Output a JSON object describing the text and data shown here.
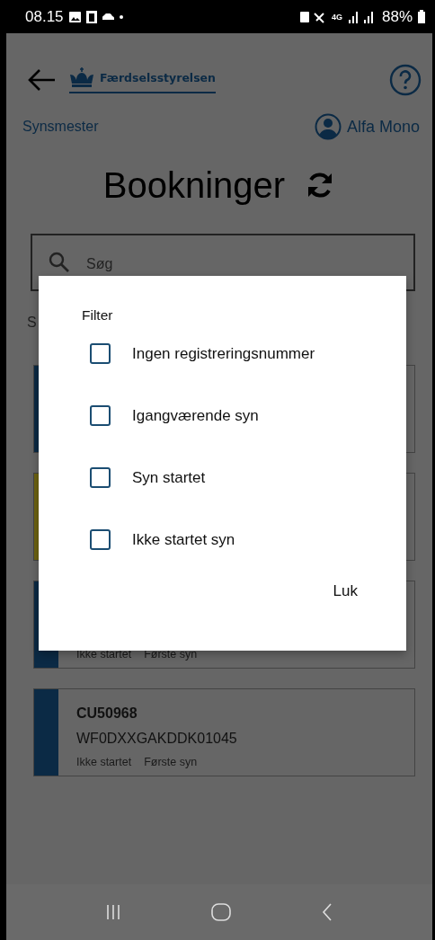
{
  "status_bar": {
    "time": "08.15",
    "network": "4G",
    "battery": "88%"
  },
  "header": {
    "logo_text": "Færdselsstyrelsen"
  },
  "role": "Synsmester",
  "user": "Alfa Mono",
  "title": "Bookninger",
  "search": {
    "placeholder": "Søg"
  },
  "section_label": "S",
  "bookings": [
    {
      "color": "#0b2a45"
    },
    {
      "color": "#6e6412"
    },
    {
      "color": "#0b2a45",
      "status": "Ikke startet",
      "type": "Første syn"
    },
    {
      "color": "#0b2a45",
      "plate": "CU50968",
      "vin": "WF0DXXGAKDDK01045",
      "status": "Ikke startet",
      "type": "Første syn"
    }
  ],
  "dialog": {
    "title": "Filter",
    "options": [
      {
        "label": "Ingen registreringsnummer",
        "checked": false
      },
      {
        "label": "Igangværende syn",
        "checked": false
      },
      {
        "label": "Syn startet",
        "checked": false
      },
      {
        "label": "Ikke startet syn",
        "checked": false
      }
    ],
    "close_button": "Luk"
  }
}
